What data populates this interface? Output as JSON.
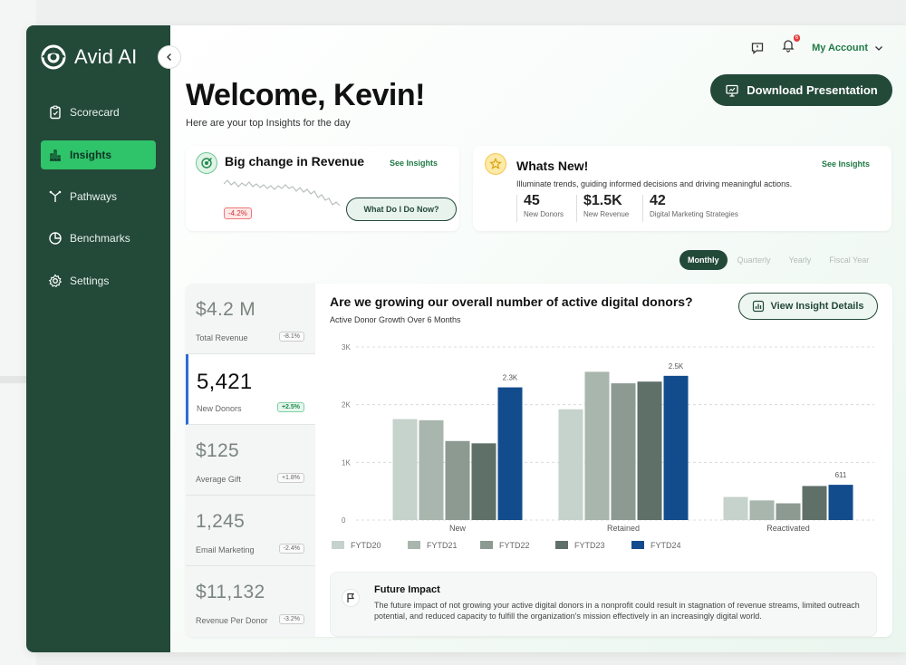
{
  "brand": {
    "name": "Avid AI"
  },
  "sidebar": {
    "items": [
      {
        "label": "Scorecard",
        "icon": "clipboard-icon",
        "active": false
      },
      {
        "label": "Insights",
        "icon": "bar-chart-icon",
        "active": true
      },
      {
        "label": "Pathways",
        "icon": "pathways-icon",
        "active": false
      },
      {
        "label": "Benchmarks",
        "icon": "pie-chart-icon",
        "active": false
      },
      {
        "label": "Settings",
        "icon": "gear-icon",
        "active": false
      }
    ]
  },
  "header": {
    "account_label": "My Account",
    "notification_count": "6",
    "download_label": "Download Presentation"
  },
  "welcome": {
    "title": "Welcome, Kevin!",
    "subtitle": "Here are your top Insights for the day"
  },
  "revenue_card": {
    "title": "Big change in Revenue",
    "see_label": "See Insights",
    "change_badge": "-4.2%",
    "button_label": "What Do I Do Now?"
  },
  "whats_new": {
    "title": "Whats New!",
    "see_label": "See Insights",
    "description": "Illuminate trends, guiding informed decisions and driving meaningful actions.",
    "stats": [
      {
        "value": "45",
        "label": "New Donors"
      },
      {
        "value": "$1.5K",
        "label": "New Revenue"
      },
      {
        "value": "42",
        "label": "Digital Marketing Strategies"
      }
    ]
  },
  "period_tabs": [
    "Monthly",
    "Quarterly",
    "Yearly",
    "Fiscal Year"
  ],
  "metrics": [
    {
      "value": "$4.2 M",
      "label": "Total Revenue",
      "badge": "-8.1%"
    },
    {
      "value": "5,421",
      "label": "New Donors",
      "badge": "+2.5%"
    },
    {
      "value": "$125",
      "label": "Average Gift",
      "badge": "+1.8%"
    },
    {
      "value": "1,245",
      "label": "Email Marketing",
      "badge": "-2.4%"
    },
    {
      "value": "$11,132",
      "label": "Revenue Per Donor",
      "badge": "-3.2%"
    }
  ],
  "insight": {
    "question": "Are we growing our overall number of active digital donors?",
    "subtitle": "Active Donor Growth Over 6 Months",
    "button_label": "View Insight Details"
  },
  "chart_data": {
    "type": "bar",
    "categories": [
      "New",
      "Retained",
      "Reactivated"
    ],
    "series": [
      {
        "name": "FYTD20",
        "color": "#c6d2cc",
        "values": [
          1750,
          1920,
          400
        ]
      },
      {
        "name": "FYTD21",
        "color": "#a8b6ae",
        "values": [
          1730,
          2570,
          340
        ]
      },
      {
        "name": "FYTD22",
        "color": "#8c9a92",
        "values": [
          1370,
          2370,
          290
        ]
      },
      {
        "name": "FYTD23",
        "color": "#5f7068",
        "values": [
          1330,
          2400,
          590
        ]
      },
      {
        "name": "FYTD24",
        "color": "#124c8c",
        "values": [
          2300,
          2500,
          611
        ]
      }
    ],
    "data_labels": [
      {
        "category": "New",
        "series": "FYTD24",
        "text": "2.3K"
      },
      {
        "category": "Retained",
        "series": "FYTD24",
        "text": "2.5K"
      },
      {
        "category": "Reactivated",
        "series": "FYTD24",
        "text": "611"
      }
    ],
    "yticks": [
      "0",
      "1K",
      "2K",
      "3K"
    ],
    "ylim": [
      0,
      3000
    ],
    "grid": true,
    "legend_position": "bottom"
  },
  "future_impact": {
    "title": "Future Impact",
    "text": "The future impact of not growing your active digital donors in a nonprofit could result in stagnation of revenue streams, limited outreach potential, and reduced capacity to fulfill the organization's mission effectively in an increasingly digital world."
  },
  "colors": {
    "sidebar_bg": "#234939",
    "accent_green": "#2fc36a",
    "link_green": "#1f7a45",
    "highlight_blue": "#124c8c"
  }
}
